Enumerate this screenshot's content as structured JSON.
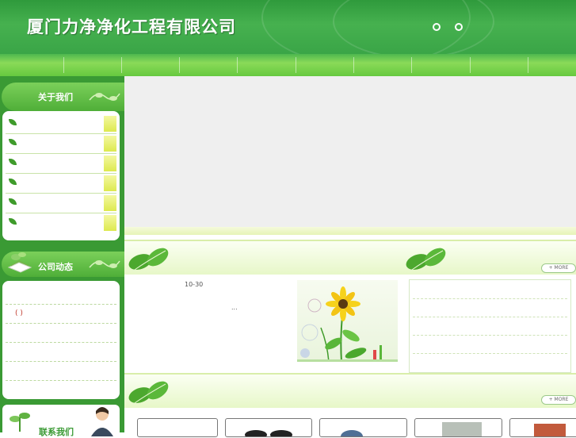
{
  "header": {
    "title": "厦门力净净化工程有限公司",
    "dots": [
      "。",
      "。"
    ]
  },
  "nav": {
    "items": [
      "",
      "",
      "",
      "",
      "",
      "",
      "",
      "",
      "",
      ""
    ]
  },
  "sidebar": {
    "about_title": "关于我们",
    "about_items": [
      "",
      "",
      "",
      "",
      "",
      ""
    ],
    "news_title": "公司动态",
    "news_items": [
      "",
      "( )",
      "",
      "",
      "",
      ""
    ],
    "contact_title": "联系我们"
  },
  "main": {
    "section1": {
      "more_label": "+ MORE"
    },
    "news": {
      "date": "10-30",
      "ellipsis": "..."
    },
    "section2": {
      "more_label": "+ MORE"
    }
  },
  "colors": {
    "header_green": "#3aa547",
    "nav_green": "#8ada58",
    "sidebar_green": "#3a9a34",
    "banner_gray": "#efefef"
  }
}
